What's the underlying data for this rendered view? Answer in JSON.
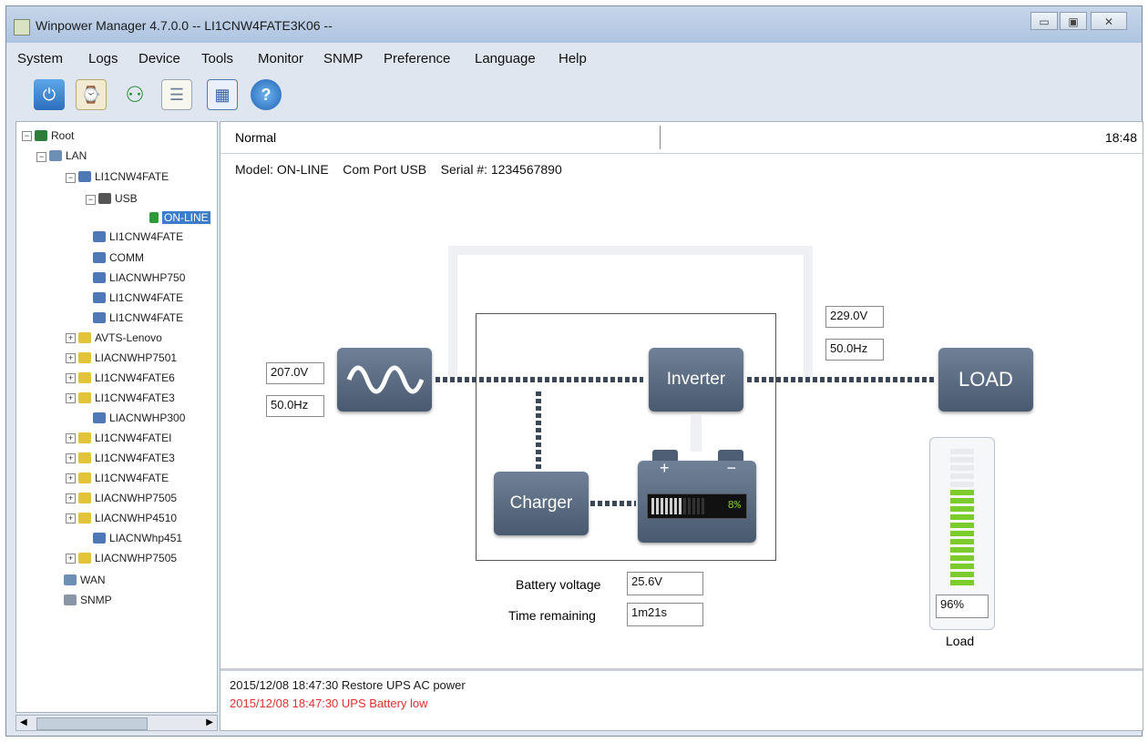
{
  "window": {
    "title": "Winpower Manager 4.7.0.0 -- LI1CNW4FATE3K06 --"
  },
  "menu": [
    "System",
    "Logs",
    "Device",
    "Tools",
    "Monitor",
    "SNMP",
    "Preference",
    "Language",
    "Help"
  ],
  "toolbar": {
    "icons": [
      "power-icon",
      "schedule-icon",
      "users-icon",
      "list-icon",
      "calculator-icon",
      "help-icon"
    ]
  },
  "tree": {
    "root": "Root",
    "lan": "LAN",
    "host1": "LI1CNW4FATE",
    "usb": "USB",
    "online": "ON-LINE",
    "items": [
      "LI1CNW4FATE",
      "COMM",
      "LIACNWHP750",
      "LI1CNW4FATE",
      "LI1CNW4FATE",
      "AVTS-Lenovo",
      "LIACNWHP7501",
      "LI1CNW4FATE6",
      "LI1CNW4FATE3",
      "LIACNWHP300",
      "LI1CNW4FATEI",
      "LI1CNW4FATE3",
      "LI1CNW4FATE",
      "LIACNWHP7505",
      "LIACNWHP4510",
      "LIACNWhp451",
      "LIACNWHP7505"
    ],
    "wan": "WAN",
    "snmp": "SNMP"
  },
  "status": {
    "state": "Normal",
    "time": "18:48"
  },
  "device": {
    "model": "Model: ON-LINE",
    "port": "Com Port USB",
    "serial": "Serial #: 1234567890"
  },
  "input": {
    "voltage": "207.0V",
    "frequency": "50.0Hz"
  },
  "output": {
    "voltage": "229.0V",
    "frequency": "50.0Hz"
  },
  "labels": {
    "inverter": "Inverter",
    "charger": "Charger",
    "load": "LOAD",
    "load_caption": "Load",
    "battery_voltage": "Battery voltage",
    "time_remaining": "Time remaining"
  },
  "battery": {
    "percent": "8%",
    "level": 0.08,
    "voltage": "25.6V",
    "time_remaining": "1m21s"
  },
  "load": {
    "percent": "96%",
    "level": 0.96
  },
  "log": [
    {
      "text": "2015/12/08 18:47:30  Restore UPS AC power",
      "color": "#1a1a1a"
    },
    {
      "text": "2015/12/08 18:47:30  UPS Battery low",
      "color": "#e03030"
    }
  ],
  "colors": {
    "accent": "#3d7cc9",
    "alarm": "#e03030",
    "battery_green": "#7ccc2c"
  }
}
